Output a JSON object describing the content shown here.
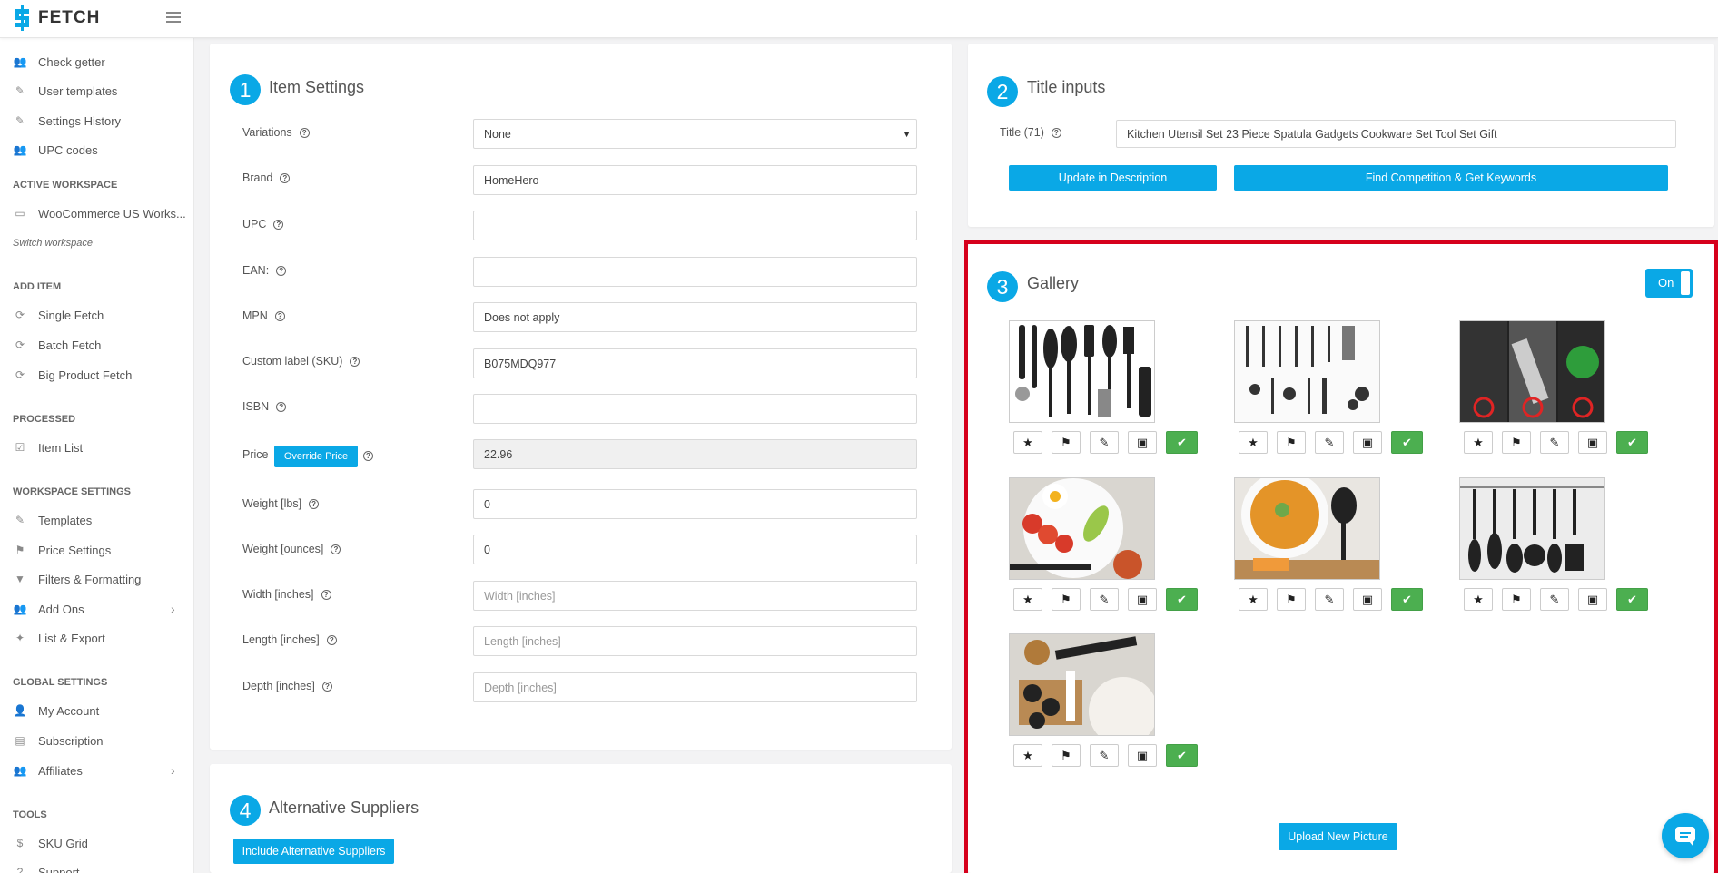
{
  "app": {
    "name": "FETCH"
  },
  "sidebar": {
    "items_top": [
      {
        "label": "Check getter",
        "icon": "users-icon"
      },
      {
        "label": "User templates",
        "icon": "brush-icon"
      },
      {
        "label": "Settings History",
        "icon": "brush-icon"
      },
      {
        "label": "UPC codes",
        "icon": "users-icon"
      }
    ],
    "active_workspace_heading": "ACTIVE WORKSPACE",
    "workspace_label": "WooCommerce US Works...",
    "switch_workspace": "Switch workspace",
    "add_item_heading": "ADD ITEM",
    "add_item": [
      {
        "label": "Single Fetch",
        "icon": "fetch-icon"
      },
      {
        "label": "Batch Fetch",
        "icon": "fetch-icon"
      },
      {
        "label": "Big Product Fetch",
        "icon": "fetch-icon"
      }
    ],
    "processed_heading": "PROCESSED",
    "processed": [
      {
        "label": "Item List",
        "icon": "checklist-icon"
      }
    ],
    "workspace_settings_heading": "WORKSPACE SETTINGS",
    "workspace_settings": [
      {
        "label": "Templates",
        "icon": "brush-icon"
      },
      {
        "label": "Price Settings",
        "icon": "tag-icon"
      },
      {
        "label": "Filters & Formatting",
        "icon": "filter-icon"
      },
      {
        "label": "Add Ons",
        "icon": "users-icon"
      },
      {
        "label": "List & Export",
        "icon": "wand-icon"
      }
    ],
    "global_settings_heading": "GLOBAL SETTINGS",
    "global_settings": [
      {
        "label": "My Account",
        "icon": "user-icon"
      },
      {
        "label": "Subscription",
        "icon": "receipt-icon"
      },
      {
        "label": "Affiliates",
        "icon": "users-icon"
      }
    ],
    "tools_heading": "TOOLS",
    "tools": [
      {
        "label": "SKU Grid",
        "icon": "dollar-icon"
      },
      {
        "label": "Support",
        "icon": "support-icon"
      }
    ]
  },
  "item_settings": {
    "number": "1",
    "title": "Item Settings",
    "fields": [
      {
        "label": "Variations",
        "value": "None",
        "type": "select"
      },
      {
        "label": "Brand",
        "value": "HomeHero"
      },
      {
        "label": "UPC",
        "value": ""
      },
      {
        "label": "EAN:",
        "value": ""
      },
      {
        "label": "MPN",
        "value": "Does not apply"
      },
      {
        "label": "Custom label (SKU)",
        "value": "B075MDQ977"
      },
      {
        "label": "ISBN",
        "value": ""
      },
      {
        "label": "Price",
        "value": "22.96",
        "disabled": true
      },
      {
        "label": "Weight [lbs]",
        "value": "0"
      },
      {
        "label": "Weight [ounces]",
        "value": "0"
      },
      {
        "label": "Width [inches]",
        "placeholder": "Width [inches]"
      },
      {
        "label": "Length [inches]",
        "placeholder": "Length [inches]"
      },
      {
        "label": "Depth [inches]",
        "placeholder": "Depth [inches]"
      }
    ],
    "override_price_label": "Override Price"
  },
  "title_inputs": {
    "number": "2",
    "title": "Title inputs",
    "label": "Title (71)",
    "value": "Kitchen Utensil Set 23 Piece Spatula Gadgets Cookware Set Tool Set Gift",
    "update_button": "Update in Description",
    "competition_button": "Find Competition & Get Keywords"
  },
  "gallery": {
    "number": "3",
    "title": "Gallery",
    "toggle_label": "On",
    "images": [
      {
        "name": "utensil-set-overview"
      },
      {
        "name": "utensil-set-labeled"
      },
      {
        "name": "material-features"
      },
      {
        "name": "breakfast-plate"
      },
      {
        "name": "soup-bowl-ladle"
      },
      {
        "name": "hanging-utensils"
      },
      {
        "name": "measuring-cups-flour"
      }
    ],
    "upload_button": "Upload New Picture"
  },
  "alternative_suppliers": {
    "number": "4",
    "title": "Alternative Suppliers",
    "include_button": "Include Alternative Suppliers"
  },
  "colors": {
    "accent": "#0aa8e6",
    "success": "#4caf50",
    "highlight": "#d6001c"
  }
}
